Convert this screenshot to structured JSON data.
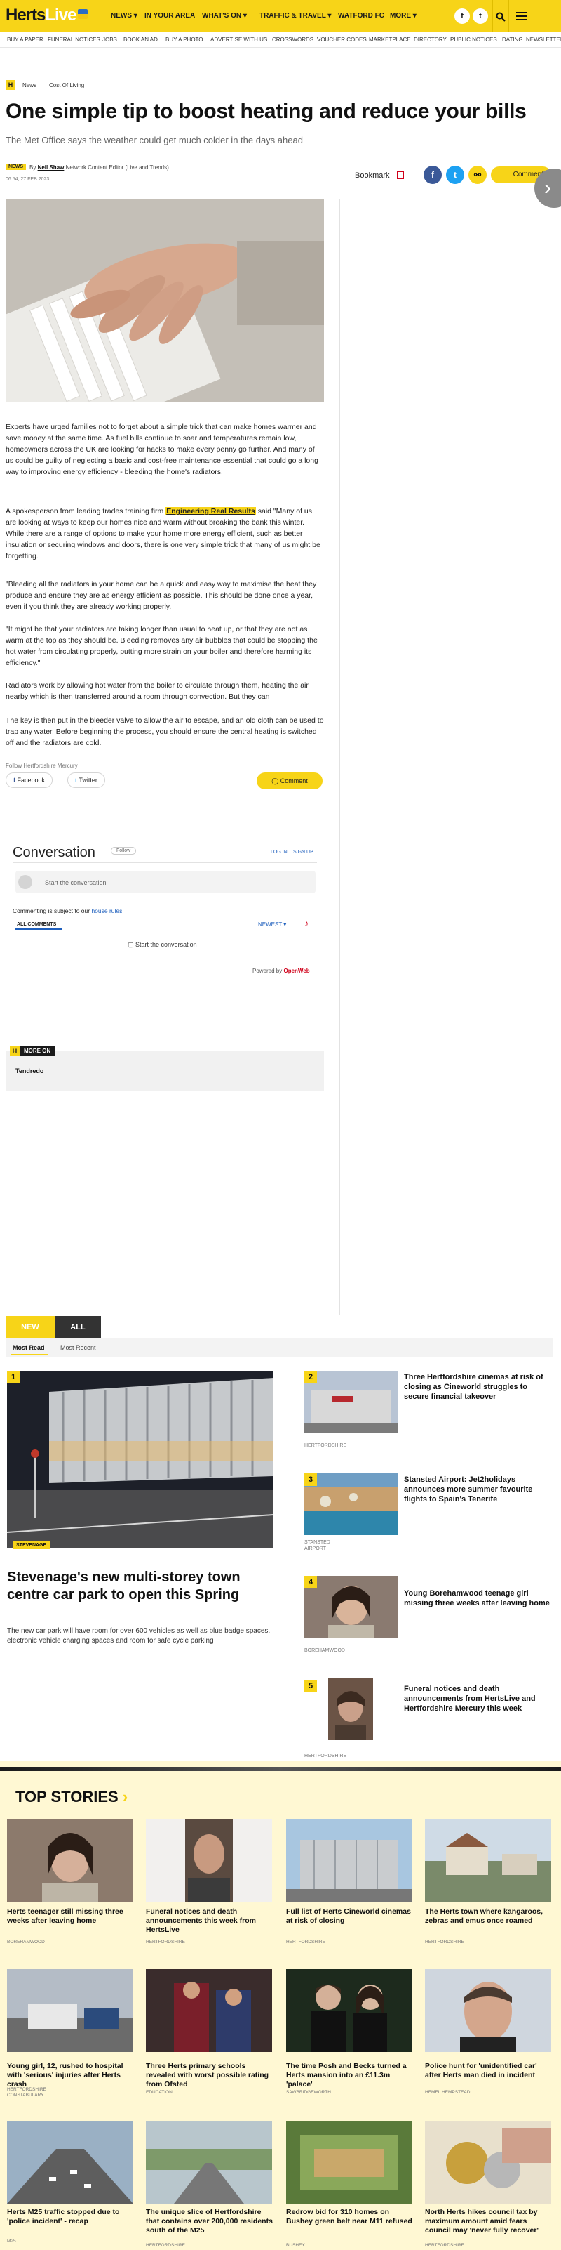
{
  "header": {
    "logo_part1": "Herts",
    "logo_part2": "Live",
    "nav": [
      "NEWS ▾",
      "IN YOUR AREA",
      "WHAT'S ON ▾",
      "TRAFFIC & TRAVEL ▾",
      "WATFORD FC",
      "MORE ▾"
    ],
    "social": [
      "f",
      "t"
    ],
    "search_icon": "search-icon",
    "accent_color": "#f7d418"
  },
  "subnav": [
    "BUY A PAPER",
    "FUNERAL NOTICES",
    "JOBS",
    "BOOK AN AD",
    "BUY A PHOTO",
    "ADVERTISE WITH US",
    "CROSSWORDS",
    "VOUCHER CODES",
    "MARKETPLACE",
    "DIRECTORY",
    "PUBLIC NOTICES",
    "DATING",
    "NEWSLETTERS"
  ],
  "article": {
    "breadcrumb": [
      "News",
      "Cost Of Living"
    ],
    "headline": "One simple tip to boost heating and reduce your bills",
    "standfirst": "The Met Office says the weather could get much colder in the days ahead",
    "badge": "NEWS",
    "byline_prefix": "By",
    "author": "Neil Shaw",
    "author_role": "Network Content Editor (Live and Trends)",
    "date": "06:54, 27 FEB 2023",
    "bookmark_label": "Bookmark",
    "comments_label": "Comments",
    "paragraphs": [
      "Experts have urged families not to forget about a simple trick that can make homes warmer and save money at the same time. As fuel bills continue to soar and temperatures remain low, homeowners across the UK are looking for hacks to make every penny go further. And many of us could be guilty of neglecting a basic and cost-free maintenance essential that could go a long way to improving energy efficiency - bleeding the home's radiators.",
      "A spokesperson from leading trades training firm",
      "Engineering Real Results",
      "said \"Many of us are looking at ways to keep our homes nice and warm without breaking the bank this winter. While there are a range of options to make your home more energy efficient, such as better insulation or securing windows and doors, there is one very simple trick that many of us might be forgetting.",
      "\"Bleeding all the radiators in your home can be a quick and easy way to maximise the heat they produce and ensure they are as energy efficient as possible. This should be done once a year, even if you think they are already working properly.",
      "\"It might be that your radiators are taking longer than usual to heat up, or that they are not as warm at the top as they should be. Bleeding removes any air bubbles that could be stopping the hot water from circulating properly, putting more strain on your boiler and therefore harming its efficiency.\"",
      "Radiators work by allowing hot water from the boiler to circulate through them, heating the air nearby which is then transferred around a room through convection. But they can",
      "The key is then put in the bleeder valve to allow the air to escape, and an old cloth can be used to trap any water. Before beginning the process, you should ensure the central heating is switched off and the radiators are cold."
    ],
    "follow": "Follow Hertfordshire Mercury",
    "share_facebook": "Facebook",
    "share_twitter": "Twitter",
    "comment_button": "Comment"
  },
  "conversation": {
    "title": "Conversation",
    "pill": "Follow",
    "login": "LOG IN",
    "signup": "SIGN UP",
    "input_placeholder": "Start the conversation",
    "rules_prefix": "Commenting is subject to our",
    "rules_link": "house rules.",
    "all_comments": "ALL COMMENTS",
    "newest": "NEWEST ▾",
    "start": "Start the conversation",
    "powered_prefix": "Powered by",
    "powered_brand": "OpenWeb"
  },
  "more_on": {
    "label": "MORE ON",
    "tag": "Tendredo"
  },
  "most_read": {
    "tabs": [
      "NEW",
      "ALL"
    ],
    "sub_tabs": [
      "Most Read",
      "Most Recent"
    ],
    "lead": {
      "rank": "1",
      "category": "STEVENAGE",
      "title": "Stevenage's new multi-storey town centre car park to open this Spring",
      "summary": "The new car park will have room for over 600 vehicles as well as blue badge spaces, electronic vehicle charging spaces and room for safe cycle parking"
    },
    "items": [
      {
        "rank": "2",
        "title": "Three Hertfordshire cinemas at risk of closing as Cineworld struggles to secure financial takeover",
        "location": "HERTFORDSHIRE"
      },
      {
        "rank": "3",
        "title": "Stansted Airport: Jet2holidays announces more summer favourite flights to Spain's Tenerife",
        "location": "STANSTED AIRPORT"
      },
      {
        "rank": "4",
        "title": "Young Borehamwood teenage girl missing three weeks after leaving home",
        "location": "BOREHAMWOOD"
      },
      {
        "rank": "5",
        "title": "Funeral notices and death announcements from HertsLive and Hertfordshire Mercury this week",
        "location": "HERTFORDSHIRE"
      }
    ]
  },
  "top_stories": {
    "title": "TOP STORIES",
    "chevron": "›",
    "items": [
      {
        "title": "Herts teenager still missing three weeks after leaving home",
        "location": "BOREHAMWOOD"
      },
      {
        "title": "Funeral notices and death announcements this week from HertsLive",
        "location": "HERTFORDSHIRE"
      },
      {
        "title": "Full list of Herts Cineworld cinemas at risk of closing",
        "location": "HERTFORDSHIRE"
      },
      {
        "title": "The Herts town where kangaroos, zebras and emus once roamed",
        "location": "HERTFORDSHIRE"
      },
      {
        "title": "Young girl, 12, rushed to hospital with 'serious' injuries after Herts crash",
        "location": "HERTFORDSHIRE CONSTABULARY"
      },
      {
        "title": "Three Herts primary schools revealed with worst possible rating from Ofsted",
        "location": "EDUCATION"
      },
      {
        "title": "The time Posh and Becks turned a Herts mansion into an £11.3m 'palace'",
        "location": "SAWBRIDGEWORTH"
      },
      {
        "title": "Police hunt for 'unidentified car' after Herts man died in incident",
        "location": "HEMEL HEMPSTEAD"
      },
      {
        "title": "Herts M25 traffic stopped due to 'police incident' - recap",
        "location": "M25"
      },
      {
        "title": "The unique slice of Hertfordshire that contains over 200,000 residents south of the M25",
        "location": "HERTFORDSHIRE"
      },
      {
        "title": "Redrow bid for 310 homes on Bushey green belt near M11 refused",
        "location": "BUSHEY"
      },
      {
        "title": "North Herts hikes council tax by maximum amount amid fears council may 'never fully recover'",
        "location": "HERTFORDSHIRE"
      }
    ]
  }
}
